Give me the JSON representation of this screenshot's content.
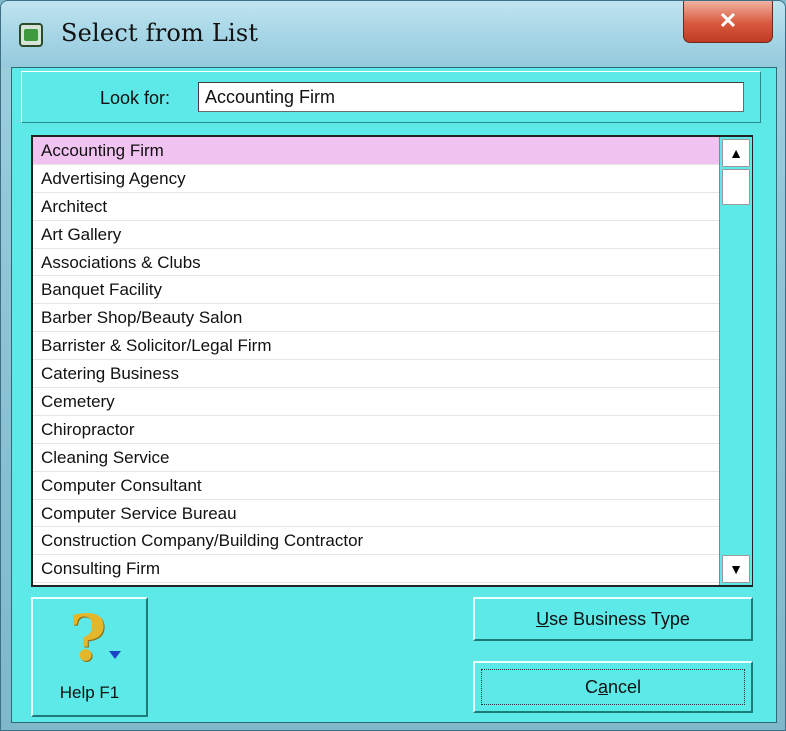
{
  "window": {
    "title": "Select from List",
    "close_glyph": "✕"
  },
  "search": {
    "label": "Look for:",
    "value": "Accounting Firm"
  },
  "list": {
    "selected_index": 0,
    "items": [
      "Accounting Firm",
      "Advertising Agency",
      "Architect",
      "Art Gallery",
      "Associations & Clubs",
      "Banquet Facility",
      "Barber Shop/Beauty Salon",
      "Barrister & Solicitor/Legal Firm",
      "Catering Business",
      "Cemetery",
      "Chiropractor",
      "Cleaning Service",
      "Computer Consultant",
      "Computer Service Bureau",
      "Construction Company/Building Contractor",
      "Consulting Firm"
    ]
  },
  "scrollbar": {
    "up_glyph": "▲",
    "down_glyph": "▼"
  },
  "help": {
    "icon_glyph": "?",
    "label": "Help F1"
  },
  "buttons": {
    "use_business_type": {
      "accel": "U",
      "rest": "se Business Type"
    },
    "cancel": {
      "before": "C",
      "accel": "a",
      "after": "ncel"
    }
  },
  "colors": {
    "dialog_bg": "#5ee9e9",
    "selected_row": "#f1c3f1",
    "close_button": "#d8583d",
    "help_icon": "#e4b62a"
  }
}
